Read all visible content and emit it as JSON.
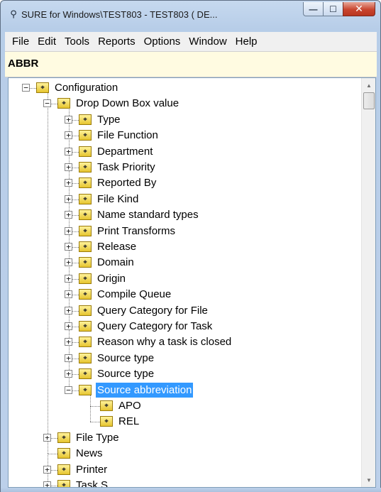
{
  "window": {
    "title": "SURE for Windows\\TEST803 - TEST803 ( DE...",
    "app_icon": "binoculars-icon",
    "min_glyph": "—",
    "max_glyph": "☐",
    "close_glyph": "✕"
  },
  "menu": [
    "File",
    "Edit",
    "Tools",
    "Reports",
    "Options",
    "Window",
    "Help"
  ],
  "path_bar": "ABBR",
  "node_icon": "key-folder-icon",
  "tree": [
    {
      "label": "Configuration",
      "level": 0,
      "expander": "minus"
    },
    {
      "label": "Drop Down Box value",
      "level": 1,
      "expander": "minus"
    },
    {
      "label": "Type",
      "level": 2,
      "expander": "plus"
    },
    {
      "label": "File Function",
      "level": 2,
      "expander": "plus"
    },
    {
      "label": "Department",
      "level": 2,
      "expander": "plus"
    },
    {
      "label": "Task Priority",
      "level": 2,
      "expander": "plus"
    },
    {
      "label": "Reported By",
      "level": 2,
      "expander": "plus"
    },
    {
      "label": "File Kind",
      "level": 2,
      "expander": "plus"
    },
    {
      "label": "Name standard types",
      "level": 2,
      "expander": "plus"
    },
    {
      "label": "Print Transforms",
      "level": 2,
      "expander": "plus"
    },
    {
      "label": "Release",
      "level": 2,
      "expander": "plus"
    },
    {
      "label": "Domain",
      "level": 2,
      "expander": "plus"
    },
    {
      "label": "Origin",
      "level": 2,
      "expander": "plus"
    },
    {
      "label": "Compile Queue",
      "level": 2,
      "expander": "plus"
    },
    {
      "label": "Query Category for File",
      "level": 2,
      "expander": "plus"
    },
    {
      "label": "Query Category for Task",
      "level": 2,
      "expander": "plus"
    },
    {
      "label": "Reason why a task is closed",
      "level": 2,
      "expander": "plus"
    },
    {
      "label": "Source type",
      "level": 2,
      "expander": "plus"
    },
    {
      "label": "Source type",
      "level": 2,
      "expander": "plus"
    },
    {
      "label": "Source abbreviation",
      "level": 2,
      "expander": "minus",
      "selected": true
    },
    {
      "label": "APO",
      "level": 3,
      "expander": "none"
    },
    {
      "label": "REL",
      "level": 3,
      "expander": "none"
    },
    {
      "label": "File Type",
      "level": 1,
      "expander": "plus"
    },
    {
      "label": "News",
      "level": 1,
      "expander": "none"
    },
    {
      "label": "Printer",
      "level": 1,
      "expander": "plus"
    },
    {
      "label": "Task S...",
      "level": 1,
      "expander": "plus"
    }
  ]
}
